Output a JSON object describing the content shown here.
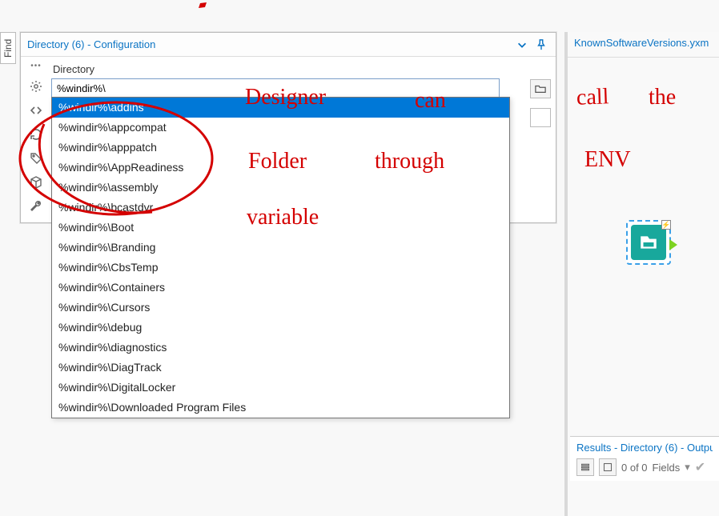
{
  "find_tab": {
    "label": "Find"
  },
  "config": {
    "title": "Directory (6) - Configuration",
    "field_label": "Directory",
    "input_value": "%windir%\\",
    "autocomplete": [
      "%windir%\\addins",
      "%windir%\\appcompat",
      "%windir%\\apppatch",
      "%windir%\\AppReadiness",
      "%windir%\\assembly",
      "%windir%\\bcastdvr",
      "%windir%\\Boot",
      "%windir%\\Branding",
      "%windir%\\CbsTemp",
      "%windir%\\Containers",
      "%windir%\\Cursors",
      "%windir%\\debug",
      "%windir%\\diagnostics",
      "%windir%\\DiagTrack",
      "%windir%\\DigitalLocker",
      "%windir%\\Downloaded Program Files"
    ],
    "selected_index": 0
  },
  "canvas": {
    "tab_title": "KnownSoftwareVersions.yxm"
  },
  "results": {
    "title": "Results - Directory (6) - Outpu",
    "fields_text_left": "0 of 0",
    "fields_text_right": "Fields"
  },
  "annotation_words": {
    "w1": "Designer",
    "w2": "can",
    "w3": "call",
    "w4": "the",
    "w5": "Folder",
    "w6": "through",
    "w7": "ENV",
    "w8": "variable"
  },
  "colors": {
    "accent_blue": "#0b74c4",
    "selection_blue": "#0078d7",
    "tool_teal": "#18a89c",
    "ink_red": "#d40000"
  }
}
